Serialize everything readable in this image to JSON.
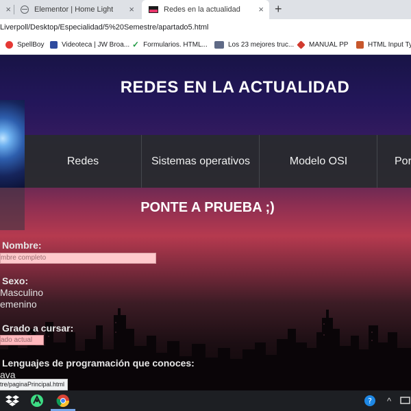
{
  "browser": {
    "tabs": [
      {
        "label": ""
      },
      {
        "label": "Elementor | Home Light"
      },
      {
        "label": "Redes en la actualidad",
        "active": true
      }
    ],
    "new_tab_icon": "+",
    "close_icon": "×",
    "url": "Liverpoll/Desktop/Especialidad/5%20Semestre/apartado5.html",
    "bookmarks": [
      {
        "label": "SpellBoy",
        "icon": "spellboy-icon"
      },
      {
        "label": "Videoteca | JW Broa...",
        "icon": "jw-icon"
      },
      {
        "label": "Formularios. HTML...",
        "icon": "checkmark-icon"
      },
      {
        "label": "Los 23 mejores truc...",
        "icon": "article-icon"
      },
      {
        "label": "MANUAL PP",
        "icon": "diamond-icon"
      },
      {
        "label": "HTML Input Typ",
        "icon": "html-icon"
      }
    ]
  },
  "page": {
    "title": "REDES EN LA ACTUALIDAD",
    "nav": [
      "Redes",
      "Sistemas operativos",
      "Modelo OSI",
      "Por"
    ],
    "section_title": "PONTE A PRUEBA ;)",
    "form": {
      "name_label": "Nombre:",
      "name_placeholder": "mbre completo",
      "sex_label": "Sexo:",
      "sex_options": [
        "Masculino",
        "emenino"
      ],
      "grade_label": "Grado a cursar:",
      "grade_value": "ado actual",
      "languages_label": "Lenguajes de programación que conoces:",
      "languages_first": "ava"
    },
    "status_url": "tre/paginaPrincipal.html"
  },
  "colors": {
    "tab_strip": "#dee1e6",
    "nav_bar": "#282a2e",
    "input_fill": "#ffc9cc",
    "taskbar": "#1d1f23"
  }
}
